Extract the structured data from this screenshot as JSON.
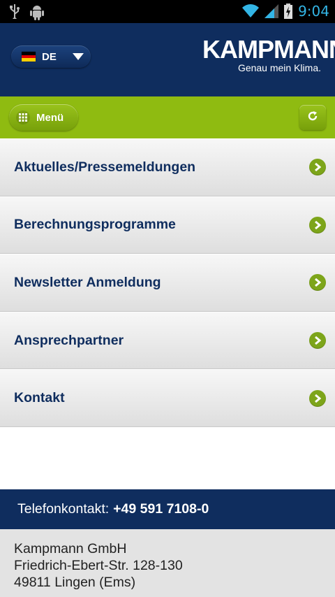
{
  "status_bar": {
    "time": "9:04",
    "icons": [
      "usb-icon",
      "android-debug-icon",
      "wifi-icon",
      "signal-icon",
      "battery-charging-icon"
    ]
  },
  "header": {
    "language": {
      "code": "DE",
      "flag": "germany-flag-icon"
    },
    "brand": {
      "name": "KAMPMANN",
      "tagline": "Genau mein Klima."
    }
  },
  "toolbar": {
    "menu_label": "Menü",
    "refresh_icon": "refresh-icon"
  },
  "nav_items": [
    {
      "label": "Aktuelles/Pressemeldungen"
    },
    {
      "label": "Berechnungsprogramme"
    },
    {
      "label": "Newsletter Anmeldung"
    },
    {
      "label": "Ansprechpartner"
    },
    {
      "label": "Kontakt"
    }
  ],
  "footer": {
    "phone_label": "Telefonkontakt:",
    "phone_number": "+49 591 7108-0",
    "address_lines": [
      "Kampmann GmbH",
      "Friedrich-Ebert-Str. 128-130",
      "49811 Lingen (Ems)"
    ]
  },
  "colors": {
    "navy": "#0f2d5e",
    "green": "#8fbb11",
    "accent_blue": "#33b5e5"
  }
}
